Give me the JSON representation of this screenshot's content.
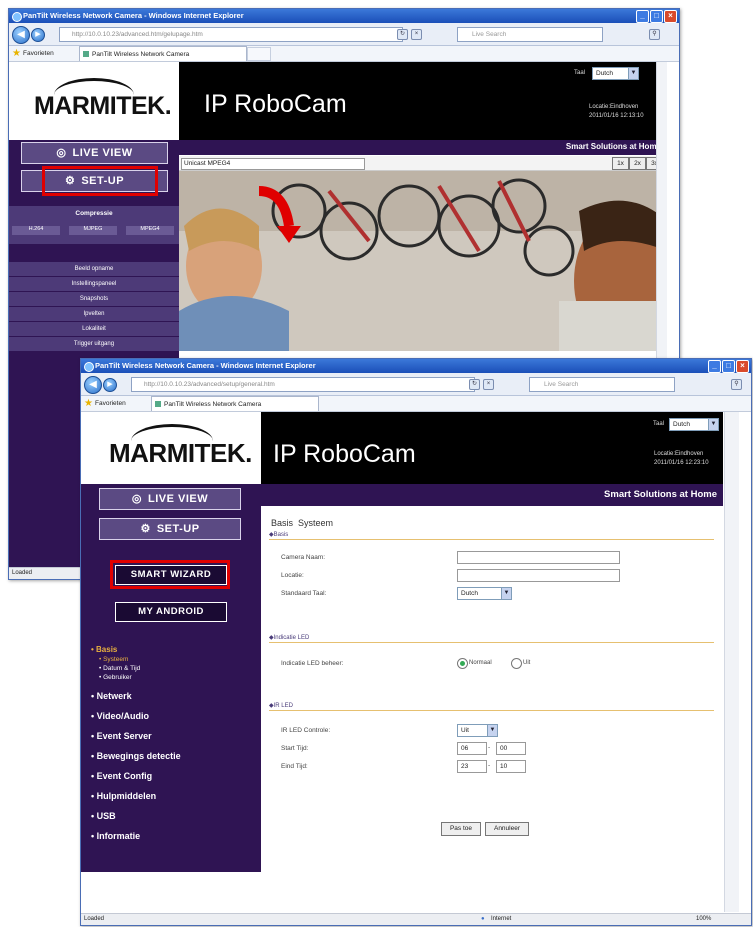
{
  "browser": {
    "title": "PanTilt Wireless Network Camera - Windows Internet Explorer",
    "back": "◀",
    "forward": "▶",
    "addr_back": "http://10.0.10.23/advanced.htm/gelupage.htm",
    "addr_front": "http://10.0.10.23/advanced/setup/general.htm",
    "search": "Live Search",
    "favorites_label": "Favorieten",
    "tab_label": "PanTilt Wireless Network Camera",
    "status_back": "Loaded",
    "status_front": "Loaded",
    "status_zone": "Internet",
    "zoom": "100%"
  },
  "brand": {
    "logo": "MARMITEK.",
    "product": "IP RoboCam",
    "slogan": "Smart Solutions at Home"
  },
  "header": {
    "lang_label": "Taal",
    "lang_value": "Dutch",
    "location": "Locatie:Eindhoven",
    "datetime_back": "2011/01/16 12:13:10",
    "datetime_front": "2011/01/16 12:23:10"
  },
  "menu": {
    "live_view": "LIVE VIEW",
    "setup": "SET-UP",
    "smart_wizard": "SMART WIZARD",
    "my_android": "MY ANDROID"
  },
  "back_page": {
    "stream_label": "Unicast MPEG4",
    "zoom_buttons": [
      "1x",
      "2x",
      "3x"
    ],
    "compression_title": "Compressie",
    "compression_options": [
      "H.264",
      "MJPEG",
      "MPEG4"
    ],
    "side_items": [
      "Beeld opname",
      "Instellingspaneel",
      "Snapshots",
      "Ipvelten",
      "Lokaliteit",
      "Trigger uitgang"
    ]
  },
  "front_nav": {
    "basis": "Basis",
    "basis_subs": [
      "Systeem",
      "Datum & Tijd",
      "Gebruiker"
    ],
    "items": [
      "Netwerk",
      "Video/Audio",
      "Event Server",
      "Bewegings detectie",
      "Event Config",
      "Hulpmiddelen",
      "USB",
      "Informatie"
    ]
  },
  "form": {
    "breadcrumb": "Basis  Systeem",
    "sect_basis": "Basis",
    "camera_name_label": "Camera Naam:",
    "camera_name_value": "",
    "location_label": "Locatie:",
    "location_value": "",
    "std_lang_label": "Standaard Taal:",
    "std_lang_value": "Dutch",
    "sect_led": "Indicatie LED",
    "led_label": "Indicatie LED beheer:",
    "led_opt1": "Normaal",
    "led_opt2": "Uit",
    "sect_ir": "IR LED",
    "ir_label": "IR LED Controle:",
    "ir_value": "Uit",
    "start_label": "Start Tijd:",
    "start_h": "06",
    "start_m": "00",
    "end_label": "Eind Tijd:",
    "end_h": "23",
    "end_m": "10",
    "apply": "Pas toe",
    "cancel": "Annuleer"
  }
}
